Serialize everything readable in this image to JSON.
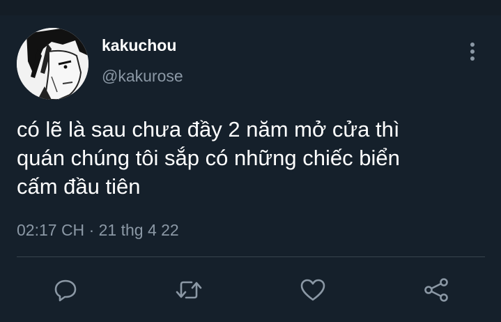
{
  "tweet": {
    "author": {
      "display_name": "kakuchou",
      "handle": "@kakurose",
      "avatar_icon": "avatar-image"
    },
    "text_lines": [
      "có lẽ là sau chưa đầy 2 năm mở cửa thì",
      "quán chúng tôi sắp có những chiếc biển",
      "cấm đầu tiên"
    ],
    "time": "02:17 CH",
    "separator": "·",
    "date": "21 thg 4 22"
  },
  "actions": [
    {
      "icon": "reply-icon"
    },
    {
      "icon": "retweet-icon"
    },
    {
      "icon": "like-icon"
    },
    {
      "icon": "share-icon"
    }
  ],
  "colors": {
    "background": "#15202b",
    "text": "#ffffff",
    "muted": "#8b98a5",
    "divider": "#38444d"
  }
}
